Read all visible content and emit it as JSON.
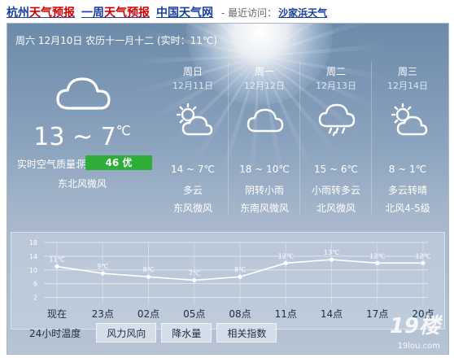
{
  "topbar": {
    "links": [
      {
        "pre": "杭州",
        "hl": "天气预报",
        "post": ""
      },
      {
        "pre": "一周",
        "hl": "天气预报",
        "post": ""
      },
      {
        "pre": "中国天气网",
        "hl": "",
        "post": ""
      }
    ],
    "recent_label": "- 最近访问：",
    "recent_link": "沙家浜天气"
  },
  "today": {
    "header": "周六 12月10日 农历十一月十二 (实时：11℃)",
    "icon": "cloud-icon",
    "temp": "13 ~ 7",
    "temp_unit": "℃",
    "condition": "阴",
    "wind": "东北风微风",
    "aqi_label": "实时空气质量:",
    "aqi_value": "46 优",
    "aqi_color": "#2ead38"
  },
  "forecast": [
    {
      "day": "周日",
      "date": "12月11日",
      "icon": "partly-cloudy-icon",
      "temp": "14 ~ 7℃",
      "cond": "多云",
      "wind": "东风微风"
    },
    {
      "day": "周一",
      "date": "12月12日",
      "icon": "cloud-icon",
      "temp": "18 ~ 10℃",
      "cond": "阴转小雨",
      "wind": "东南风微风"
    },
    {
      "day": "周二",
      "date": "12月13日",
      "icon": "rain-cloud-icon",
      "temp": "15 ~ 6℃",
      "cond": "小雨转多云",
      "wind": "北风微风"
    },
    {
      "day": "周三",
      "date": "12月14日",
      "icon": "partly-cloudy-icon",
      "temp": "8 ~ 1℃",
      "cond": "多云转晴",
      "wind": "北风4-5级"
    }
  ],
  "tabs": [
    "24小时温度",
    "风力风向",
    "降水量",
    "相关指数"
  ],
  "watermark": {
    "text": "19楼",
    "domain": "19lou.com"
  },
  "chart_data": {
    "type": "line",
    "title": "",
    "xlabel": "",
    "ylabel": "",
    "categories": [
      "现在",
      "23点",
      "02点",
      "05点",
      "08点",
      "11点",
      "14点",
      "17点",
      "20点"
    ],
    "series": [
      {
        "values": [
          11,
          9,
          8,
          7,
          8,
          12,
          13,
          12,
          12
        ]
      }
    ],
    "point_labels": [
      "11℃",
      "9℃",
      "8℃",
      "7℃",
      "8℃",
      "12℃",
      "13℃",
      "12℃",
      "12℃"
    ],
    "yticks": [
      2,
      6,
      10,
      14,
      18
    ],
    "ylim": [
      0,
      18
    ],
    "grid": true
  }
}
